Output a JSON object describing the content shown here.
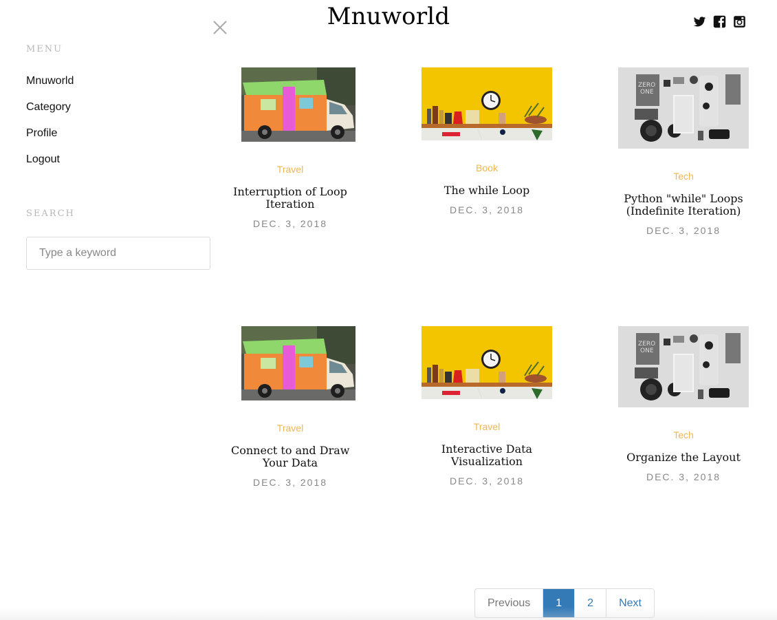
{
  "site_title": "Mnuworld",
  "social": [
    "twitter-icon",
    "facebook-icon",
    "instagram-icon"
  ],
  "accent_color": "#f0b64b",
  "link_color": "#337ab7",
  "sidebar": {
    "menu_heading": "MENU",
    "menu_items": [
      "Mnuworld",
      "Category",
      "Profile",
      "Logout"
    ],
    "search_heading": "SEARCH",
    "search_placeholder": "Type a keyword"
  },
  "posts": [
    {
      "category": "Travel",
      "title_line1": "Interruption of Loop",
      "title_line2": "Iteration",
      "date": "DEC. 3, 2018",
      "image": "camper-van"
    },
    {
      "category": "Book",
      "title_line1": "The while Loop",
      "title_line2": "",
      "date": "DEC. 3, 2018",
      "image": "yellow-shelf"
    },
    {
      "category": "Tech",
      "title_line1": "Python \"while\" Loops",
      "title_line2": "(Indefinite Iteration)",
      "date": "DEC. 3, 2018",
      "image": "flat-lay"
    },
    {
      "category": "Travel",
      "title_line1": "Connect to and Draw",
      "title_line2": "Your Data",
      "date": "DEC. 3, 2018",
      "image": "camper-van"
    },
    {
      "category": "Travel",
      "title_line1": "Interactive Data",
      "title_line2": "Visualization",
      "date": "DEC. 3, 2018",
      "image": "yellow-shelf"
    },
    {
      "category": "Tech",
      "title_line1": "Organize the Layout",
      "title_line2": "",
      "date": "DEC. 3, 2018",
      "image": "flat-lay"
    }
  ],
  "pagination": {
    "previous": "Previous",
    "pages": [
      "1",
      "2"
    ],
    "current": "1",
    "next": "Next"
  }
}
